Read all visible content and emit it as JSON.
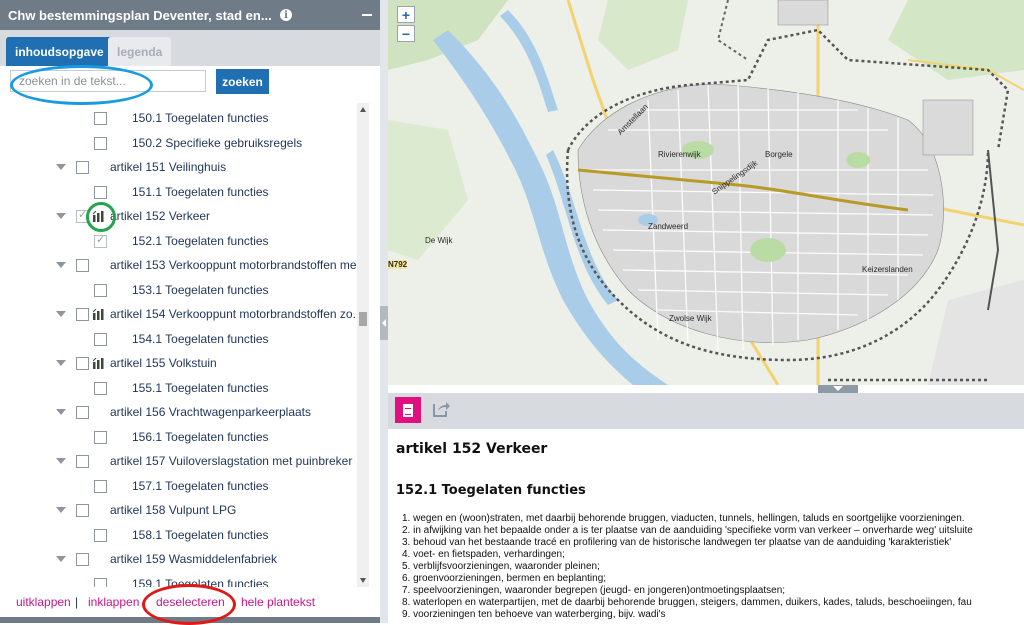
{
  "panel": {
    "title": "Chw bestemmingsplan Deventer, stad en...",
    "info_icon": "info-icon",
    "tabs": [
      {
        "label": "inhoudsopgave",
        "active": true
      },
      {
        "label": "legenda",
        "active": false
      }
    ],
    "search": {
      "placeholder": "zoeken in de tekst...",
      "value": "",
      "button_label": "zoeken"
    },
    "tree": [
      {
        "level": 2,
        "label": "150.1 Toegelaten functies",
        "checked": false
      },
      {
        "level": 2,
        "label": "150.2 Specifieke gebruiksregels",
        "checked": false
      },
      {
        "level": 1,
        "label": "artikel 151 Veilinghuis",
        "checked": false,
        "map_icon": false
      },
      {
        "level": 2,
        "label": "151.1 Toegelaten functies",
        "checked": false
      },
      {
        "level": 1,
        "label": "artikel 152 Verkeer",
        "checked": true,
        "map_icon": true
      },
      {
        "level": 2,
        "label": "152.1 Toegelaten functies",
        "checked": true
      },
      {
        "level": 1,
        "label": "artikel 153 Verkooppunt motorbrandstoffen me...",
        "checked": false,
        "map_icon": false
      },
      {
        "level": 2,
        "label": "153.1 Toegelaten functies",
        "checked": false
      },
      {
        "level": 1,
        "label": "artikel 154 Verkooppunt motorbrandstoffen zo...",
        "checked": false,
        "map_icon": true
      },
      {
        "level": 2,
        "label": "154.1 Toegelaten functies",
        "checked": false
      },
      {
        "level": 1,
        "label": "artikel 155 Volkstuin",
        "checked": false,
        "map_icon": true
      },
      {
        "level": 2,
        "label": "155.1 Toegelaten functies",
        "checked": false
      },
      {
        "level": 1,
        "label": "artikel 156 Vrachtwagenparkeerplaats",
        "checked": false,
        "map_icon": false
      },
      {
        "level": 2,
        "label": "156.1 Toegelaten functies",
        "checked": false
      },
      {
        "level": 1,
        "label": "artikel 157 Vuilоverslagstation met puinbreker",
        "checked": false,
        "map_icon": false
      },
      {
        "level": 2,
        "label": "157.1 Toegelaten functies",
        "checked": false
      },
      {
        "level": 1,
        "label": "artikel 158 Vulpunt LPG",
        "checked": false,
        "map_icon": false
      },
      {
        "level": 2,
        "label": "158.1 Toegelaten functies",
        "checked": false
      },
      {
        "level": 1,
        "label": "artikel 159 Wasmiddelenfabriek",
        "checked": false,
        "map_icon": false
      },
      {
        "level": 2,
        "label": "159.1 Toegelaten functies",
        "checked": false
      }
    ],
    "footer": {
      "expand": "uitklappen",
      "sep": "|",
      "collapse": "inklappen",
      "deselect": "deselecteren",
      "full_text": "hele plantekst"
    }
  },
  "map": {
    "zoom_in": "+",
    "zoom_out": "−",
    "labels": {
      "de_wijk": "De Wijk",
      "road": "N792",
      "rivierenwijk": "Rivierenwijk",
      "borgele": "Borgele",
      "zandweerd": "Zandweerd",
      "keizerslanden": "Keizerslanden",
      "zwolse_wijk": "Zwolse Wijk",
      "snippeling": "Snippelingsdijk",
      "amstel": "Amstellaan"
    }
  },
  "document": {
    "heading": "artikel 152 Verkeer",
    "subheading": "152.1 Toegelaten functies",
    "items": [
      "1. wegen en (woon)straten, met daarbij behorende bruggen, viaducten, tunnels, hellingen, taluds en soortgelijke voorzieningen.",
      "2. in afwijking van het bepaalde onder a is ter plaatse van de aanduiding 'specifieke vorm van verkeer – onverharde weg' uitsluite",
      "3. behoud van het bestaande tracé en profilering van de historische landwegen ter plaatse van de aanduiding 'karakteristiek'",
      "4. voet- en fietspaden, verhardingen;",
      "5. verblijfsvoorzieningen, waaronder pleinen;",
      "6. groenvoorzieningen, bermen en beplanting;",
      "7. speelvoorzieningen, waaronder begrepen (jeugd- en jongeren)ontmoetingsplaatsen;",
      "8. waterlopen en waterpartijen, met de daarbij behorende bruggen, steigers, dammen, duikers, kades, taluds, beschoeiingen, fau",
      "9. voorzieningen ten behoeve van waterberging, bijv. wadi's"
    ]
  },
  "colors": {
    "accent": "#1f6fb2",
    "link": "#c5168a",
    "doc_icon": "#e0107f",
    "header": "#6f7b86"
  }
}
